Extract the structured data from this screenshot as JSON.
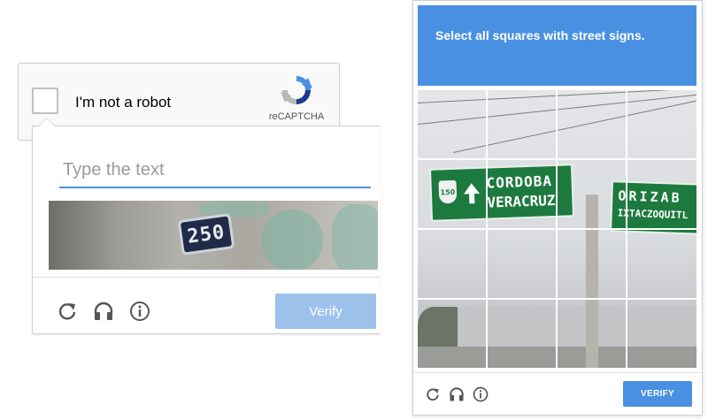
{
  "anchor": {
    "label": "I'm not a robot",
    "brand": "reCAPTCHA"
  },
  "text_challenge": {
    "input_placeholder": "Type the text",
    "input_value": "",
    "photo_text": "250",
    "verify_label": "Verify",
    "icons": [
      "reload-icon",
      "audio-icon",
      "info-icon"
    ]
  },
  "image_challenge": {
    "instructions": "Select all squares with street signs.",
    "sign_main_line1": "CORDOBA",
    "sign_main_line2": "VERACRUZ",
    "sign_shield": "150",
    "sign_right_line1": "ORIZAB",
    "sign_right_line2": "IXTACZOQUITL",
    "grid": {
      "rows": 4,
      "cols": 4
    },
    "verify_label": "VERIFY",
    "icons": [
      "reload-icon",
      "audio-icon",
      "info-icon"
    ]
  },
  "colors": {
    "accent": "#4a90e2",
    "verify_disabled": "#9cc2ec",
    "sign_green": "#1d7a3e"
  }
}
